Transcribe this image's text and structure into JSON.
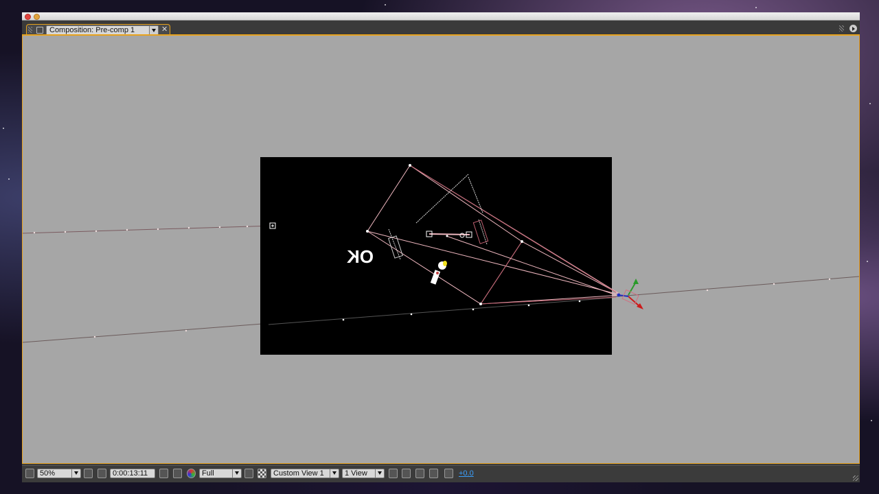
{
  "composition_panel": {
    "tab_title": "Composition: Pre-comp 1",
    "close_glyph": "✕",
    "icons": {
      "lock": "lock-icon",
      "flowchart": "play-icon"
    }
  },
  "viewer": {
    "background_color": "#a6a6a6",
    "frame_color": "#000000",
    "layer_text": "OK",
    "selection_color": "#e8a21b"
  },
  "status_bar": {
    "magnification": "50%",
    "timecode": "0:00:13:11",
    "resolution": "Full",
    "view": "Custom View 1",
    "view_layout": "1 View",
    "exposure": "+0.0"
  }
}
